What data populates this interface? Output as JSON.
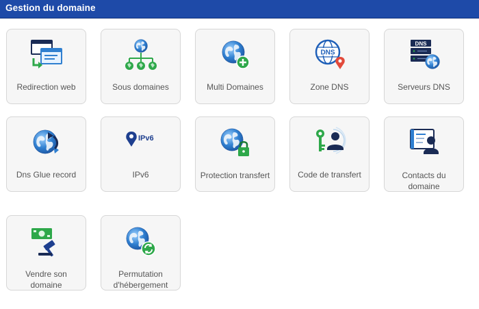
{
  "header": {
    "title": "Gestion du domaine"
  },
  "tiles": [
    {
      "label": "Redirection web",
      "icon": "web-redirect-icon"
    },
    {
      "label": "Sous domaines",
      "icon": "subdomains-icon"
    },
    {
      "label": "Multi Domaines",
      "icon": "multi-domains-icon"
    },
    {
      "label": "Zone DNS",
      "icon": "dns-zone-icon",
      "icon_text": "DNS"
    },
    {
      "label": "Serveurs DNS",
      "icon": "dns-servers-icon",
      "icon_text": "DNS"
    },
    {
      "label": "Dns Glue record",
      "icon": "dns-glue-icon"
    },
    {
      "label": "IPv6",
      "icon": "ipv6-icon",
      "icon_text": "IPv6"
    },
    {
      "label": "Protection transfert",
      "icon": "transfer-protection-icon"
    },
    {
      "label": "Code de transfert",
      "icon": "transfer-code-icon"
    },
    {
      "label": "Contacts du domaine",
      "icon": "domain-contacts-icon"
    },
    {
      "label": "Vendre son domaine",
      "icon": "sell-domain-icon"
    },
    {
      "label": "Permutation d'hébergement",
      "icon": "hosting-swap-icon"
    }
  ],
  "colors": {
    "header_bg": "#1e4aa8",
    "globe_blue": "#2f7fd0",
    "accent_green": "#2ea84a",
    "dark_navy": "#1a2b55"
  }
}
